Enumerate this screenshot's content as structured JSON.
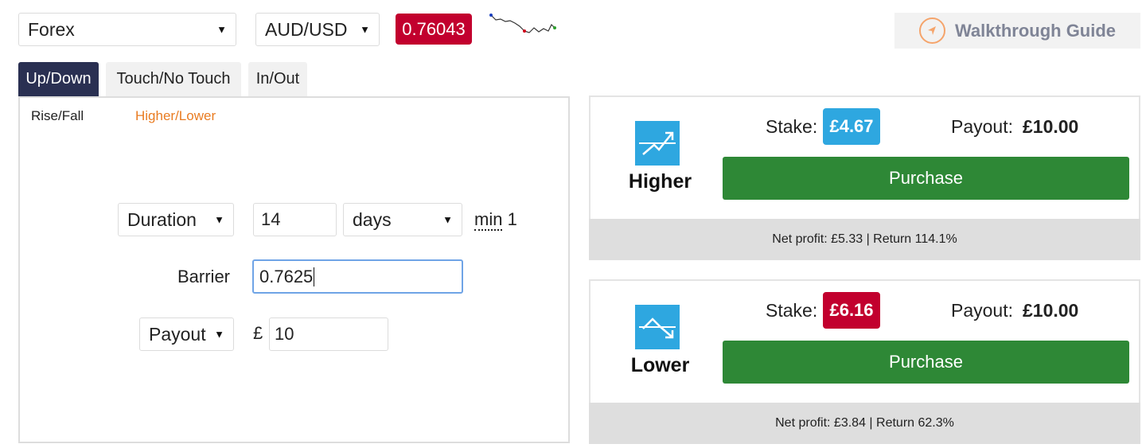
{
  "header": {
    "market": "Forex",
    "symbol": "AUD/USD",
    "spot_price": "0.76043",
    "walkthrough_label": "Walkthrough Guide"
  },
  "tabs": [
    {
      "label": "Up/Down",
      "active": true
    },
    {
      "label": "Touch/No Touch",
      "active": false
    },
    {
      "label": "In/Out",
      "active": false
    }
  ],
  "subtabs": [
    {
      "label": "Rise/Fall",
      "active": false
    },
    {
      "label": "Higher/Lower",
      "active": true
    }
  ],
  "form": {
    "duration_type": "Duration",
    "duration_amount": "14",
    "duration_unit": "days",
    "min_label": "min",
    "min_value": "1",
    "barrier_label": "Barrier",
    "barrier_value": "0.7625",
    "basis": "Payout",
    "currency": "£",
    "amount": "10"
  },
  "contracts": {
    "higher": {
      "label": "Higher",
      "stake_label": "Stake:",
      "stake": "£4.67",
      "stake_color": "#2ea7e0",
      "payout_label": "Payout:",
      "payout": "£10.00",
      "purchase_label": "Purchase",
      "info": "Net profit: £5.33 | Return 114.1%"
    },
    "lower": {
      "label": "Lower",
      "stake_label": "Stake:",
      "stake": "£6.16",
      "stake_color": "#c2002e",
      "payout_label": "Payout:",
      "payout": "£10.00",
      "purchase_label": "Purchase",
      "info": "Net profit: £3.84 | Return 62.3%"
    }
  },
  "icons": {
    "caret": "▼",
    "walkthrough": "navigation-arrow-icon",
    "higher": "trend-up-icon",
    "lower": "trend-down-icon"
  },
  "colors": {
    "active_tab": "#2a3052",
    "accent_orange": "#e97c22",
    "price_badge": "#c2002e",
    "purchase": "#2e8836",
    "contract_icon": "#2ea7e0"
  }
}
